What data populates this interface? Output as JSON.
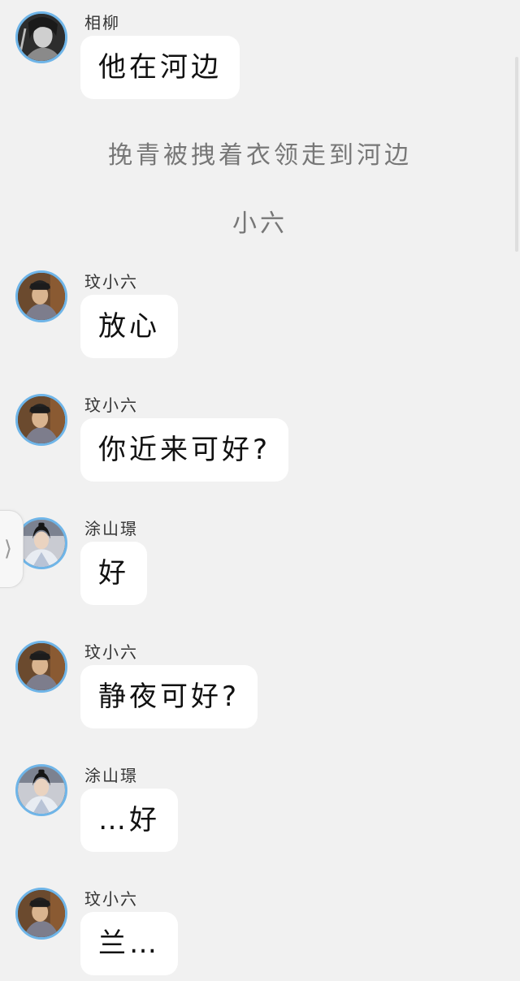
{
  "messages": [
    {
      "name": "相柳",
      "text": "他在河边",
      "avatar_icon": "xiangliu-avatar-icon"
    },
    {
      "name": "玟小六",
      "text": "放心",
      "avatar_icon": "wenxiaoliu-avatar-icon"
    },
    {
      "name": "玟小六",
      "text": "你近来可好?",
      "avatar_icon": "wenxiaoliu-avatar-icon"
    },
    {
      "name": "涂山璟",
      "text": "好",
      "avatar_icon": "tushanjing-avatar-icon"
    },
    {
      "name": "玟小六",
      "text": "静夜可好?",
      "avatar_icon": "wenxiaoliu-avatar-icon"
    },
    {
      "name": "涂山璟",
      "text": "…好",
      "avatar_icon": "tushanjing-avatar-icon"
    },
    {
      "name": "玟小六",
      "text": "兰…",
      "avatar_icon": "wenxiaoliu-avatar-icon"
    }
  ],
  "narration": [
    "挽青被拽着衣领走到河边",
    "小六"
  ],
  "side_tab": {
    "icon": "chevron-right-icon",
    "glyph": "⟩"
  },
  "colors": {
    "background": "#f1f1f1",
    "bubble": "#ffffff",
    "avatar_border": "#6fb5e8",
    "narration_text": "#777777"
  }
}
